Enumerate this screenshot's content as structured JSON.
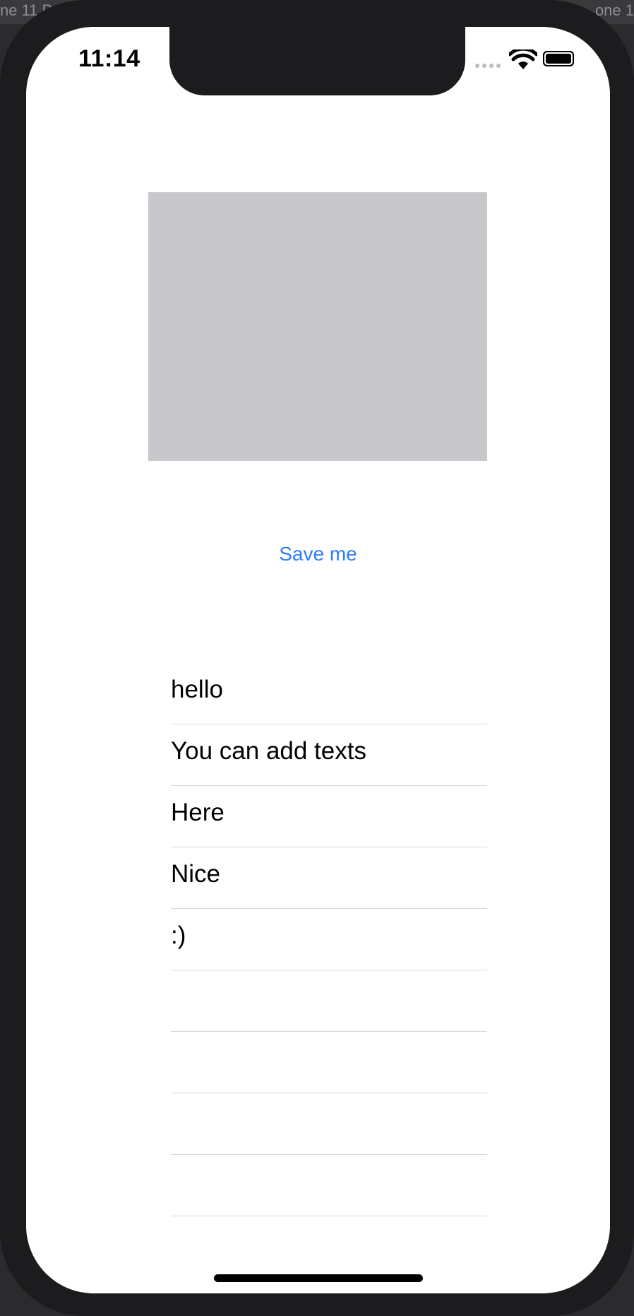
{
  "simulator": {
    "left_label": "ne 11 P",
    "right_label": "one 1"
  },
  "status_bar": {
    "time": "11:14"
  },
  "main": {
    "save_button_label": "Save me",
    "rows": [
      "hello",
      "You can add texts",
      "Here",
      "Nice",
      ":)",
      "",
      "",
      "",
      ""
    ]
  },
  "colors": {
    "accent": "#2f7cf6",
    "placeholder": "#c7c7cc",
    "separator": "#d8d8d8"
  }
}
